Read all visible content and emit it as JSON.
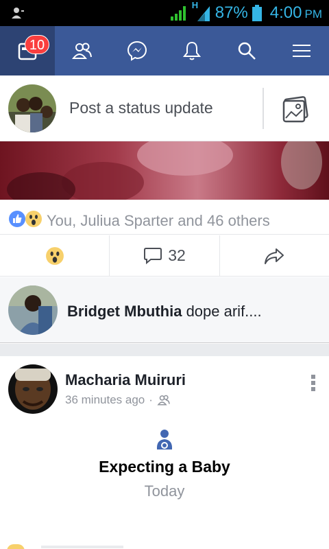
{
  "status_bar": {
    "network_type": "H",
    "battery_percent": "87%",
    "time": "4:00",
    "time_suffix": "PM",
    "icons": [
      "account-icon",
      "signal-icon",
      "battery-icon"
    ]
  },
  "nav": {
    "items": [
      {
        "name": "news-feed",
        "icon": "news-feed-icon",
        "badge": "10",
        "active": true
      },
      {
        "name": "friend-requests",
        "icon": "friends-icon"
      },
      {
        "name": "messenger",
        "icon": "messenger-icon"
      },
      {
        "name": "notifications",
        "icon": "bell-icon"
      },
      {
        "name": "search",
        "icon": "search-icon"
      },
      {
        "name": "menu",
        "icon": "menu-icon"
      }
    ]
  },
  "composer": {
    "placeholder": "Post a status update",
    "photo_icon": "photo-icon"
  },
  "post1": {
    "reaction_icons": [
      "like-reaction-icon",
      "wow-reaction-icon"
    ],
    "reactions_text": "You, Juliua Sparter and 46 others",
    "comment_count": "32",
    "reacted_icon": "wow-reaction-icon"
  },
  "comment": {
    "author": "Bridget Mbuthia",
    "text": "dope arif...."
  },
  "post2": {
    "author": "Macharia Muiruri",
    "time": "36 minutes ago",
    "separator": "·",
    "audience_icon": "friends-icon",
    "life_event_icon": "baby-icon",
    "life_event_title": "Expecting a Baby",
    "life_event_date": "Today"
  },
  "colors": {
    "brand": "#3b5998",
    "brand_active": "#2d4373",
    "badge": "#fa3e3e",
    "status_blue": "#35b5e5",
    "muted_text": "#90949c"
  }
}
